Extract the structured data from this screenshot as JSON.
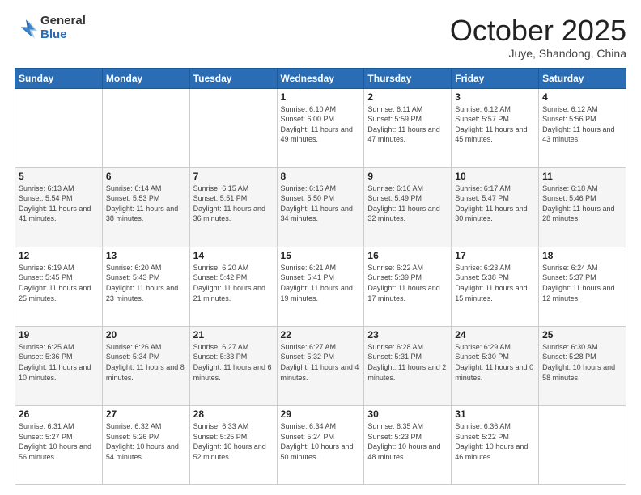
{
  "logo": {
    "general": "General",
    "blue": "Blue"
  },
  "header": {
    "month": "October 2025",
    "location": "Juye, Shandong, China"
  },
  "weekdays": [
    "Sunday",
    "Monday",
    "Tuesday",
    "Wednesday",
    "Thursday",
    "Friday",
    "Saturday"
  ],
  "weeks": [
    [
      {
        "day": "",
        "info": ""
      },
      {
        "day": "",
        "info": ""
      },
      {
        "day": "",
        "info": ""
      },
      {
        "day": "1",
        "info": "Sunrise: 6:10 AM\nSunset: 6:00 PM\nDaylight: 11 hours and 49 minutes."
      },
      {
        "day": "2",
        "info": "Sunrise: 6:11 AM\nSunset: 5:59 PM\nDaylight: 11 hours and 47 minutes."
      },
      {
        "day": "3",
        "info": "Sunrise: 6:12 AM\nSunset: 5:57 PM\nDaylight: 11 hours and 45 minutes."
      },
      {
        "day": "4",
        "info": "Sunrise: 6:12 AM\nSunset: 5:56 PM\nDaylight: 11 hours and 43 minutes."
      }
    ],
    [
      {
        "day": "5",
        "info": "Sunrise: 6:13 AM\nSunset: 5:54 PM\nDaylight: 11 hours and 41 minutes."
      },
      {
        "day": "6",
        "info": "Sunrise: 6:14 AM\nSunset: 5:53 PM\nDaylight: 11 hours and 38 minutes."
      },
      {
        "day": "7",
        "info": "Sunrise: 6:15 AM\nSunset: 5:51 PM\nDaylight: 11 hours and 36 minutes."
      },
      {
        "day": "8",
        "info": "Sunrise: 6:16 AM\nSunset: 5:50 PM\nDaylight: 11 hours and 34 minutes."
      },
      {
        "day": "9",
        "info": "Sunrise: 6:16 AM\nSunset: 5:49 PM\nDaylight: 11 hours and 32 minutes."
      },
      {
        "day": "10",
        "info": "Sunrise: 6:17 AM\nSunset: 5:47 PM\nDaylight: 11 hours and 30 minutes."
      },
      {
        "day": "11",
        "info": "Sunrise: 6:18 AM\nSunset: 5:46 PM\nDaylight: 11 hours and 28 minutes."
      }
    ],
    [
      {
        "day": "12",
        "info": "Sunrise: 6:19 AM\nSunset: 5:45 PM\nDaylight: 11 hours and 25 minutes."
      },
      {
        "day": "13",
        "info": "Sunrise: 6:20 AM\nSunset: 5:43 PM\nDaylight: 11 hours and 23 minutes."
      },
      {
        "day": "14",
        "info": "Sunrise: 6:20 AM\nSunset: 5:42 PM\nDaylight: 11 hours and 21 minutes."
      },
      {
        "day": "15",
        "info": "Sunrise: 6:21 AM\nSunset: 5:41 PM\nDaylight: 11 hours and 19 minutes."
      },
      {
        "day": "16",
        "info": "Sunrise: 6:22 AM\nSunset: 5:39 PM\nDaylight: 11 hours and 17 minutes."
      },
      {
        "day": "17",
        "info": "Sunrise: 6:23 AM\nSunset: 5:38 PM\nDaylight: 11 hours and 15 minutes."
      },
      {
        "day": "18",
        "info": "Sunrise: 6:24 AM\nSunset: 5:37 PM\nDaylight: 11 hours and 12 minutes."
      }
    ],
    [
      {
        "day": "19",
        "info": "Sunrise: 6:25 AM\nSunset: 5:36 PM\nDaylight: 11 hours and 10 minutes."
      },
      {
        "day": "20",
        "info": "Sunrise: 6:26 AM\nSunset: 5:34 PM\nDaylight: 11 hours and 8 minutes."
      },
      {
        "day": "21",
        "info": "Sunrise: 6:27 AM\nSunset: 5:33 PM\nDaylight: 11 hours and 6 minutes."
      },
      {
        "day": "22",
        "info": "Sunrise: 6:27 AM\nSunset: 5:32 PM\nDaylight: 11 hours and 4 minutes."
      },
      {
        "day": "23",
        "info": "Sunrise: 6:28 AM\nSunset: 5:31 PM\nDaylight: 11 hours and 2 minutes."
      },
      {
        "day": "24",
        "info": "Sunrise: 6:29 AM\nSunset: 5:30 PM\nDaylight: 11 hours and 0 minutes."
      },
      {
        "day": "25",
        "info": "Sunrise: 6:30 AM\nSunset: 5:28 PM\nDaylight: 10 hours and 58 minutes."
      }
    ],
    [
      {
        "day": "26",
        "info": "Sunrise: 6:31 AM\nSunset: 5:27 PM\nDaylight: 10 hours and 56 minutes."
      },
      {
        "day": "27",
        "info": "Sunrise: 6:32 AM\nSunset: 5:26 PM\nDaylight: 10 hours and 54 minutes."
      },
      {
        "day": "28",
        "info": "Sunrise: 6:33 AM\nSunset: 5:25 PM\nDaylight: 10 hours and 52 minutes."
      },
      {
        "day": "29",
        "info": "Sunrise: 6:34 AM\nSunset: 5:24 PM\nDaylight: 10 hours and 50 minutes."
      },
      {
        "day": "30",
        "info": "Sunrise: 6:35 AM\nSunset: 5:23 PM\nDaylight: 10 hours and 48 minutes."
      },
      {
        "day": "31",
        "info": "Sunrise: 6:36 AM\nSunset: 5:22 PM\nDaylight: 10 hours and 46 minutes."
      },
      {
        "day": "",
        "info": ""
      }
    ]
  ]
}
